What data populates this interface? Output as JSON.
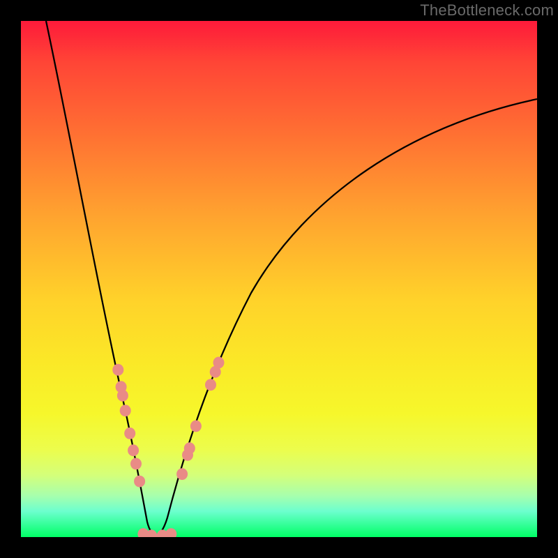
{
  "watermark": "TheBottleneck.com",
  "chart_data": {
    "type": "line",
    "title": "",
    "xlabel": "",
    "ylabel": "",
    "x_range_fraction": [
      0,
      1
    ],
    "y_range_fraction": [
      0,
      1
    ],
    "background_gradient_stops": [
      {
        "pos": 0.0,
        "color": "#fe1a3a",
        "meaning": "high-bottleneck"
      },
      {
        "pos": 0.54,
        "color": "#ffd22a",
        "meaning": "moderate"
      },
      {
        "pos": 1.0,
        "color": "#00ff66",
        "meaning": "no-bottleneck"
      }
    ],
    "series": [
      {
        "name": "bottleneck-curve",
        "notch_x_fraction": 0.262,
        "notch_y_fraction": 0.998,
        "left_start": {
          "x_fraction": 0.049,
          "y_fraction": 0.0
        },
        "right_end": {
          "x_fraction": 1.0,
          "y_fraction": 0.152
        }
      }
    ],
    "markers": {
      "color": "#e98b86",
      "radius_px": 8,
      "left_branch_y_fraction": [
        0.676,
        0.709,
        0.726,
        0.755,
        0.799,
        0.832,
        0.858,
        0.892
      ],
      "notch_y_fraction": [
        0.994,
        0.997,
        0.997,
        0.994
      ],
      "notch_x_fraction": [
        0.237,
        0.253,
        0.274,
        0.291
      ],
      "right_branch_y_fraction": [
        0.878,
        0.841,
        0.828,
        0.785,
        0.705,
        0.68,
        0.662
      ]
    }
  }
}
